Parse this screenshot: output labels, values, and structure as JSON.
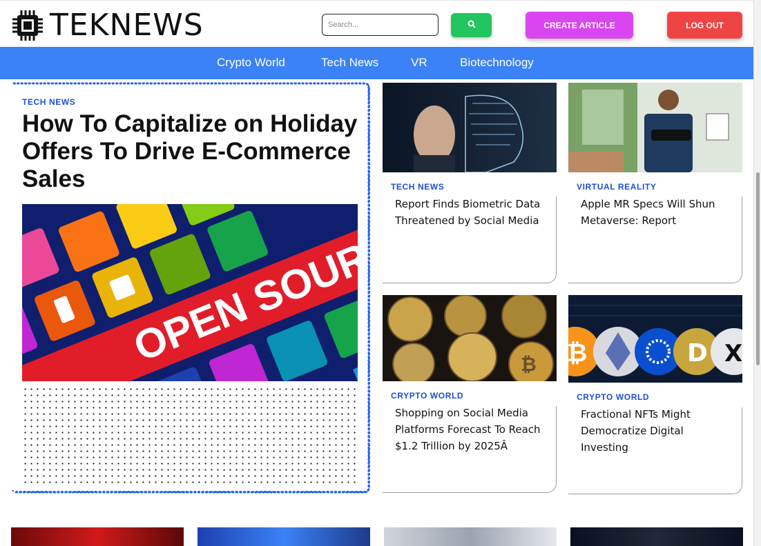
{
  "brand": {
    "name": "TEKNEWS",
    "logo_icon": "chip-icon"
  },
  "header": {
    "search_placeholder": "Search...",
    "search_button_icon": "search-icon",
    "create_label": "CREATE ARTICLE",
    "logout_label": "LOG OUT"
  },
  "nav": {
    "items": [
      "Crypto World",
      "Tech News",
      "VR",
      "Biotechnology"
    ]
  },
  "featured": {
    "category": "TECH NEWS",
    "title": "How To Capitalize on Holiday Offers To Drive E-Commerce Sales",
    "image_text": "OPEN SOURCE"
  },
  "cards": [
    {
      "category": "TECH NEWS",
      "title": "Report Finds Biometric Data Threatened by Social Media"
    },
    {
      "category": "VIRTUAL REALITY",
      "title": "Apple MR Specs Will Shun Metaverse: Report"
    },
    {
      "category": "CRYPTO WORLD",
      "title": "Shopping on Social Media Platforms Forecast To Reach $1.2 Trillion by 2025Â"
    },
    {
      "category": "CRYPTO WORLD",
      "title": "Fractional NFTs Might Democratize Digital Investing"
    }
  ],
  "colors": {
    "nav_bg": "#3b82f6",
    "search_btn": "#22c55e",
    "create_btn": "#d946ef",
    "logout_btn": "#ef4444",
    "category": "#1d4ed8",
    "featured_border": "#2563eb"
  }
}
